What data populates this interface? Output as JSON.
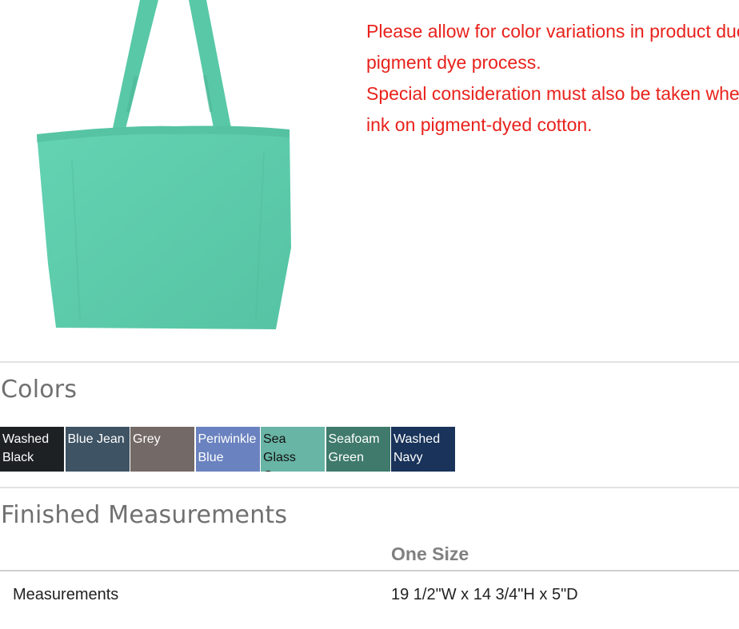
{
  "product": {
    "image_alt": "tote-bag",
    "bag_color": "#5fcfae"
  },
  "notice": {
    "line1": "Please allow for color variations in product due to the",
    "line2": "pigment dye process.",
    "line3": "Special consideration must also be taken when printing",
    "line4": "ink on pigment-dyed cotton."
  },
  "colors": {
    "title": "Colors",
    "swatches": [
      {
        "label": "Washed\nBlack",
        "color": "#1d2124",
        "text_color": "#ffffff"
      },
      {
        "label": "Blue Jean",
        "color": "#3e5363",
        "text_color": "#ffffff"
      },
      {
        "label": "Grey",
        "color": "#736966",
        "text_color": "#ffffff"
      },
      {
        "label": "Periwinkle\nBlue",
        "color": "#6a82bf",
        "text_color": "#ffffff"
      },
      {
        "label": "Sea\nGlass\nGreen",
        "color": "#68b4a5",
        "text_color": "#111111"
      },
      {
        "label": "Seafoam\nGreen",
        "color": "#3f7a6c",
        "text_color": "#ffffff"
      },
      {
        "label": "Washed\nNavy",
        "color": "#19335a",
        "text_color": "#ffffff"
      }
    ]
  },
  "measurements": {
    "title": "Finished Measurements",
    "column_header": "One Size",
    "rows": [
      {
        "label": "Measurements",
        "value": "19 1/2\"W x 14 3/4\"H x 5\"D"
      }
    ]
  }
}
